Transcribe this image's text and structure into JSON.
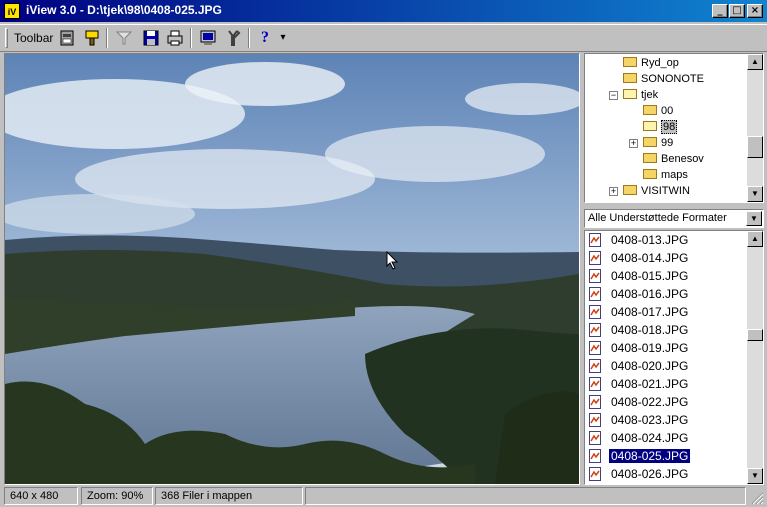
{
  "window": {
    "title": "iView 3.0 - D:\\tjek\\98\\0408-025.JPG",
    "app_icon": "iview-app-icon",
    "minimize_glyph": "_",
    "maximize_glyph": "□",
    "close_glyph": "×"
  },
  "toolbar": {
    "label": "Toolbar",
    "icons": [
      "scanner-icon",
      "paint-brush-icon",
      "funnel-icon",
      "save-icon",
      "print-icon",
      "monitor-icon",
      "tools-icon",
      "help-icon",
      "dropdown-arrow-icon"
    ],
    "help_glyph": "?",
    "dropdown_glyph": "▾"
  },
  "tree": {
    "items": [
      {
        "label": "Ryd_op"
      },
      {
        "label": "SONONOTE"
      },
      {
        "label": "tjek",
        "expander": "−"
      },
      {
        "label": "00"
      },
      {
        "label": "98"
      },
      {
        "label": "99",
        "expander": "+"
      },
      {
        "label": "Benesov"
      },
      {
        "label": "maps"
      },
      {
        "label": "VISITWIN",
        "expander": "+"
      }
    ],
    "selected": "98"
  },
  "filter": {
    "value": "Alle Understøttede Formater",
    "arrow": "▼"
  },
  "files": {
    "items": [
      "0408-013.JPG",
      "0408-014.JPG",
      "0408-015.JPG",
      "0408-016.JPG",
      "0408-017.JPG",
      "0408-018.JPG",
      "0408-019.JPG",
      "0408-020.JPG",
      "0408-021.JPG",
      "0408-022.JPG",
      "0408-023.JPG",
      "0408-024.JPG",
      "0408-025.JPG",
      "0408-026.JPG"
    ],
    "selected": "0408-025.JPG"
  },
  "scroll": {
    "up": "▲",
    "down": "▼"
  },
  "status": {
    "dimensions": "640 x 480",
    "zoom": "Zoom: 90%",
    "file_count": "368 Filer i mappen"
  },
  "colors": {
    "titlebar": "#000080",
    "selection": "#000080",
    "face": "#c0c0c0"
  }
}
